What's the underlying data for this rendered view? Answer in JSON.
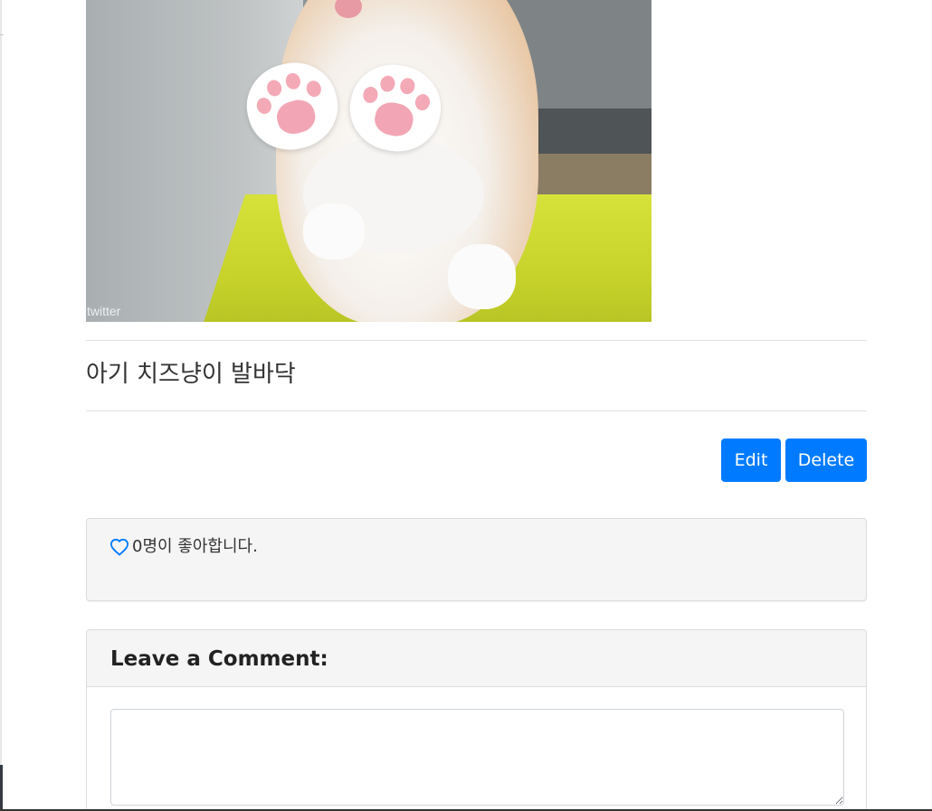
{
  "post": {
    "image_watermark": "twitter",
    "title": "아기 치즈냥이 발바닥"
  },
  "actions": {
    "edit_label": "Edit",
    "delete_label": "Delete"
  },
  "likes": {
    "icon": "heart-outline-icon",
    "text": "0명이 좋아합니다."
  },
  "comment_form": {
    "heading": "Leave a Comment:",
    "textarea_value": ""
  },
  "colors": {
    "primary": "#007bff",
    "card_bg": "#f5f5f5",
    "card_border": "#dcdcdc"
  }
}
